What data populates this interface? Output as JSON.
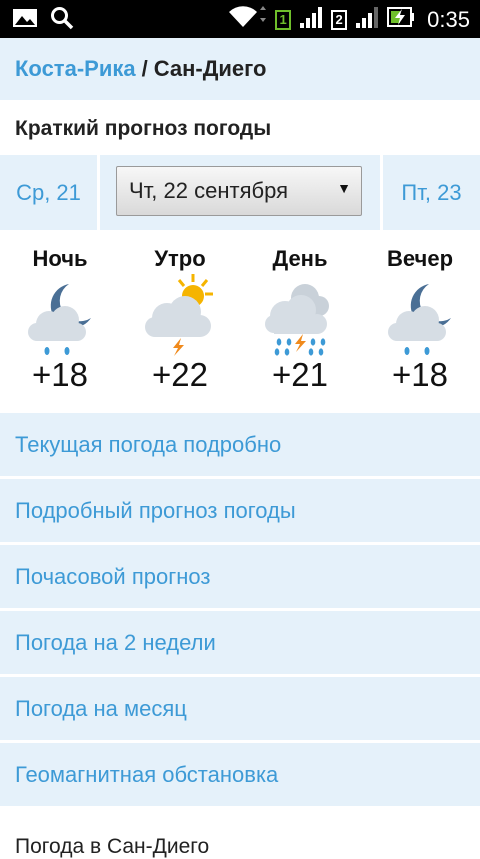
{
  "status_bar": {
    "icons": [
      "image-icon",
      "search-icon",
      "wifi-icon",
      "sim1-icon",
      "signal1-icon",
      "sim2-icon",
      "signal2-icon",
      "battery-charging-icon"
    ],
    "sim1_label": "1",
    "sim2_label": "2",
    "time": "0:35"
  },
  "breadcrumb": {
    "country": "Коста-Рика",
    "separator": "/",
    "city": "Сан-Диего"
  },
  "section_title": "Краткий прогноз погоды",
  "days": {
    "prev": "Ср, 21",
    "selected": "Чт, 22 сентября",
    "next": "Пт, 23"
  },
  "periods": [
    {
      "name": "Ночь",
      "icon": "night-rain-icon",
      "temp": "+18"
    },
    {
      "name": "Утро",
      "icon": "sun-thunderstorm-icon",
      "temp": "+22"
    },
    {
      "name": "День",
      "icon": "thunderstorm-heavy-rain-icon",
      "temp": "+21"
    },
    {
      "name": "Вечер",
      "icon": "night-rain-icon",
      "temp": "+18"
    }
  ],
  "menu": [
    "Текущая погода подробно",
    "Подробный прогноз погоды",
    "Почасовой прогноз",
    "Погода на 2 недели",
    "Погода на месяц",
    "Геомагнитная обстановка"
  ],
  "bottom_title": "Погода в Сан-Диего",
  "colors": {
    "accent": "#3d9ad6",
    "panel": "#e5f1fa",
    "statusbar": "#000000",
    "sun": "#f5b400",
    "lightning": "#f08a1c",
    "rain": "#3d9ad6",
    "moon": "#4a6f95"
  }
}
